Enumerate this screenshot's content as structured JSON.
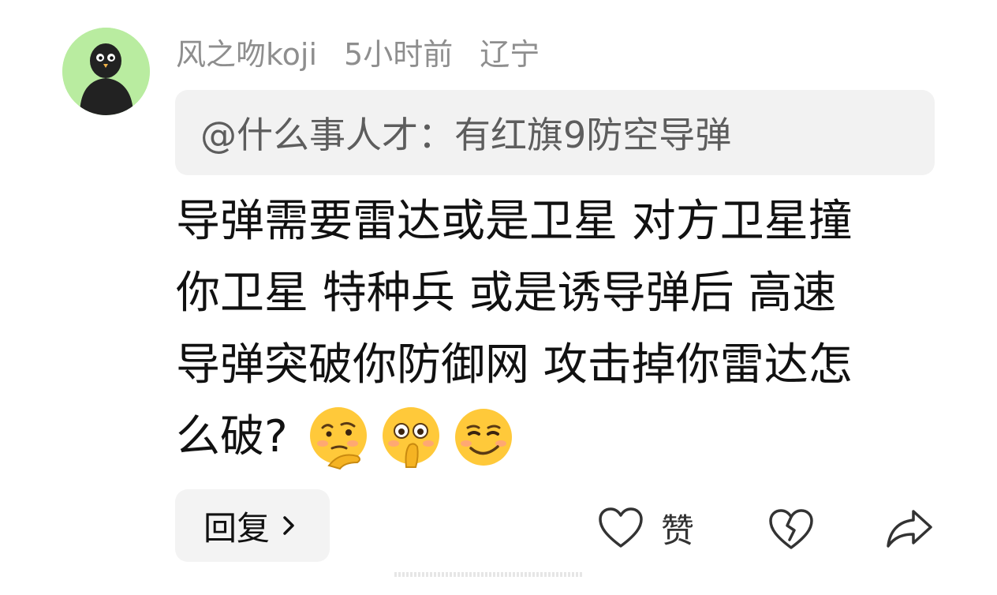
{
  "comment": {
    "author": "风之吻koji",
    "time": "5小时前",
    "location": "辽宁",
    "quote": "@什么事人才：有红旗9防空导弹",
    "lines": [
      "导弹需要雷达或是卫星 对方卫星撞",
      "你卫星 特种兵 或是诱导弹后 高速",
      "导弹突破你防御网 攻击掉你雷达怎",
      "么破?"
    ],
    "emojis": [
      "thinking-chin-emoji",
      "covering-mouth-emoji",
      "smirk-emoji"
    ]
  },
  "actions": {
    "reply_label": "回复",
    "like_label": "赞"
  },
  "colors": {
    "avatar_bg": "#b9eca0",
    "meta_text": "#8e8e8e",
    "quote_bg": "#f2f2f2",
    "button_bg": "#f3f3f3",
    "emoji_yellow": "#ffc93a"
  }
}
